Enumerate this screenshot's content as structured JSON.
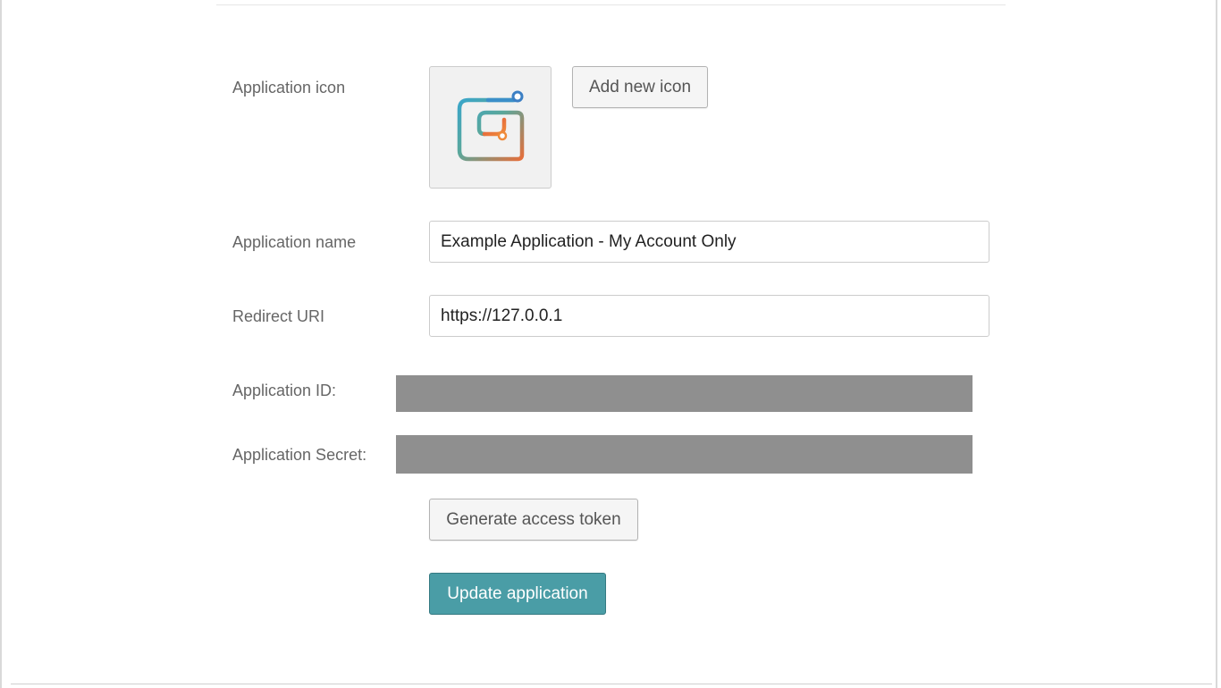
{
  "form": {
    "icon": {
      "label": "Application icon",
      "add_button_label": "Add new icon",
      "icon_name": "app-logo-icon",
      "gradient_colors": [
        "#3aa6c9",
        "#6aa88a",
        "#e56f3b",
        "#3b7fc4"
      ]
    },
    "name": {
      "label": "Application name",
      "value": "Example Application - My Account Only"
    },
    "redirect_uri": {
      "label": "Redirect URI",
      "value": "https://127.0.0.1"
    },
    "app_id": {
      "label": "Application ID:"
    },
    "app_secret": {
      "label": "Application Secret:"
    },
    "generate_token_label": "Generate access token",
    "update_label": "Update application"
  },
  "colors": {
    "primary_button": "#4a9da6",
    "redaction": "#8f8f8f"
  }
}
